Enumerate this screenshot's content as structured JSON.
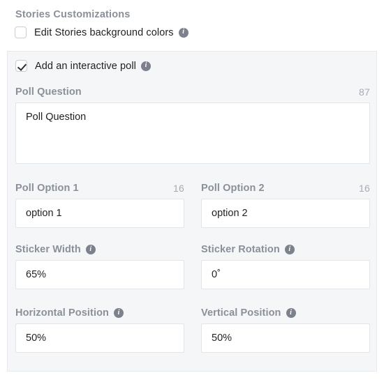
{
  "section": {
    "heading": "Stories Customizations"
  },
  "checkboxes": {
    "edit_background": {
      "label": "Edit Stories background colors",
      "checked": false,
      "info_glyph": "i"
    },
    "interactive_poll": {
      "label": "Add an interactive poll",
      "checked": true,
      "info_glyph": "i"
    }
  },
  "fields": {
    "poll_question": {
      "label": "Poll Question",
      "char_count": "87",
      "value": "Poll Question"
    },
    "poll_option_1": {
      "label": "Poll Option 1",
      "char_count": "16",
      "value": "option 1"
    },
    "poll_option_2": {
      "label": "Poll Option 2",
      "char_count": "16",
      "value": "option 2"
    },
    "sticker_width": {
      "label": "Sticker Width",
      "value": "65%",
      "info_glyph": "i"
    },
    "sticker_rotation": {
      "label": "Sticker Rotation",
      "value": "0˚",
      "info_glyph": "i"
    },
    "horizontal_position": {
      "label": "Horizontal Position",
      "value": "50%",
      "info_glyph": "i"
    },
    "vertical_position": {
      "label": "Vertical Position",
      "value": "50%",
      "info_glyph": "i"
    }
  },
  "colors": {
    "panel_background": "#f4f6f8",
    "label_text": "#8a9099",
    "value_text": "#1d2023",
    "counter_text": "#a7acb3",
    "info_icon": "#7c828c",
    "input_border": "#e2e5e9"
  }
}
